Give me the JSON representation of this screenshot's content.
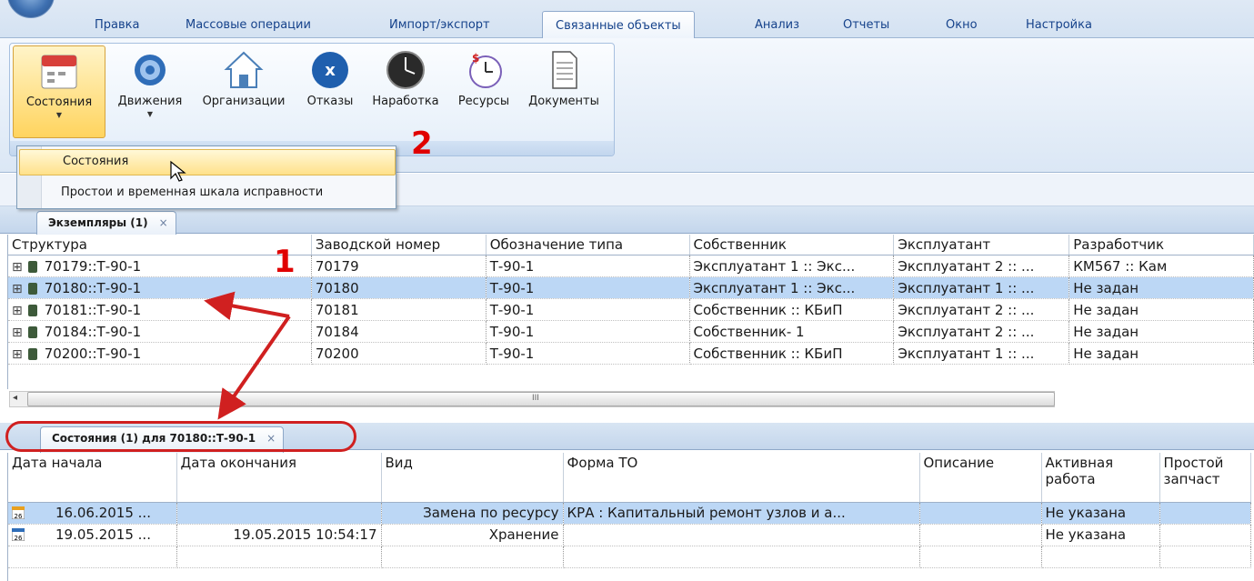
{
  "ribbon_tabs": [
    "Правка",
    "Массовые операции",
    "Импорт/экспорт",
    "Связанные объекты",
    "Анализ",
    "Отчеты",
    "Окно",
    "Настройка"
  ],
  "ribbon_buttons": [
    "Состояния",
    "Движения",
    "Организации",
    "Отказы",
    "Наработка",
    "Ресурсы",
    "Документы"
  ],
  "menu": {
    "items": [
      "Состояния",
      "Простои и временная шкала исправности"
    ]
  },
  "annotations": {
    "one": "1",
    "two": "2"
  },
  "top_tab": {
    "label": "Экземпляры (1)",
    "close": "×"
  },
  "top_grid": {
    "headers": [
      "Структура",
      "Заводской номер",
      "Обозначение типа",
      "Собственник",
      "Эксплуатант",
      "Разработчик"
    ],
    "rows": [
      [
        "70179::Т-90-1",
        "70179",
        "Т-90-1",
        "Эксплуатант 1 :: Экс...",
        "Эксплуатант 2 :: ...",
        "КМ567 :: Кам"
      ],
      [
        "70180::Т-90-1",
        "70180",
        "Т-90-1",
        "Эксплуатант 1 :: Экс...",
        "Эксплуатант 1 :: ...",
        "Не задан"
      ],
      [
        "70181::Т-90-1",
        "70181",
        "Т-90-1",
        "Собственник :: КБиП",
        "Эксплуатант 2 :: ...",
        "Не задан"
      ],
      [
        "70184::Т-90-1",
        "70184",
        "Т-90-1",
        "Собственник- 1",
        "Эксплуатант 2 :: ...",
        "Не задан"
      ],
      [
        "70200::Т-90-1",
        "70200",
        "Т-90-1",
        "Собственник :: КБиП",
        "Эксплуатант 1 :: ...",
        "Не задан"
      ]
    ],
    "tree_glyph": "⊞",
    "scroll_mark": "III",
    "scroll_left": "◂"
  },
  "bottom_tab": {
    "label": "Состояния (1) для 70180::Т-90-1",
    "close": "×"
  },
  "bottom_grid": {
    "headers": [
      "Дата начала",
      "Дата окончания",
      "Вид",
      "Форма ТО",
      "Описание",
      "Активная работа",
      "Простой запчаст"
    ],
    "rows": [
      [
        "16.06.2015 ...",
        "",
        "Замена по ресурсу",
        "КРА : Капитальный ремонт узлов и а...",
        "",
        "Не указана",
        ""
      ],
      [
        "19.05.2015 ...",
        "19.05.2015 10:54:17",
        "Хранение",
        "",
        "",
        "Не указана",
        ""
      ]
    ],
    "cal_day": "26"
  },
  "colors": {
    "accent": "#15428b",
    "selection": "#bcd7f5",
    "annotation": "#e00000"
  }
}
